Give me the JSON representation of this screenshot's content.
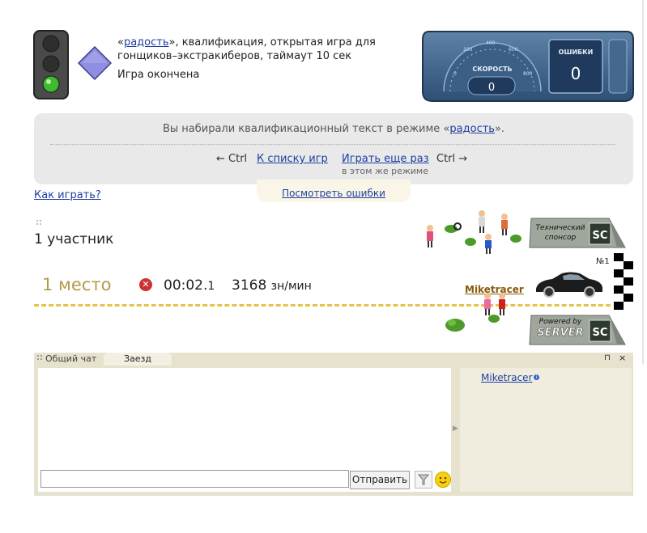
{
  "header": {
    "mode_link": "радость",
    "description_rest": "», квалификация, открытая игра для гонщиков–экстракиберов, таймаут 10 сек",
    "status": "Игра окончена"
  },
  "dashboard": {
    "speed_label": "СКОРОСТЬ",
    "speed_value": "0",
    "errors_label": "ОШИБКИ",
    "errors_value": "0",
    "scale": [
      "0",
      "200",
      "400",
      "600",
      "800"
    ]
  },
  "info": {
    "text_before": "Вы набирали квалификационный текст в режиме «",
    "mode_link": "радость",
    "text_after": "».",
    "ctrl_left": "← Ctrl",
    "to_list": "К списку игр",
    "play_again": "Играть еще раз",
    "play_again_sub": "в этом же режиме",
    "ctrl_right": "Ctrl →",
    "view_errors": "Посмотреть ошибки"
  },
  "how_to_play": "Как играть?",
  "participants": {
    "count": "1 участник"
  },
  "sponsor": {
    "line1": "Технический",
    "line2": "спонсор",
    "logo": "SC"
  },
  "powered": {
    "line1": "Powered by",
    "line2": "SERVER",
    "logo": "SC"
  },
  "result": {
    "place": "1 место",
    "time_main": "00:02.",
    "time_dec": "1",
    "speed": "3168",
    "speed_unit": "зн/мин",
    "player": "Miketracer",
    "rank": "№1"
  },
  "chat": {
    "tabs": [
      "Общий чат",
      "Заезд"
    ],
    "input_value": "",
    "send_label": "Отправить",
    "user": "Miketracer"
  },
  "colors": {
    "link": "#1c3fa0",
    "place": "#b39b4a",
    "track": "#e4c34a",
    "player": "#8a5a10"
  }
}
